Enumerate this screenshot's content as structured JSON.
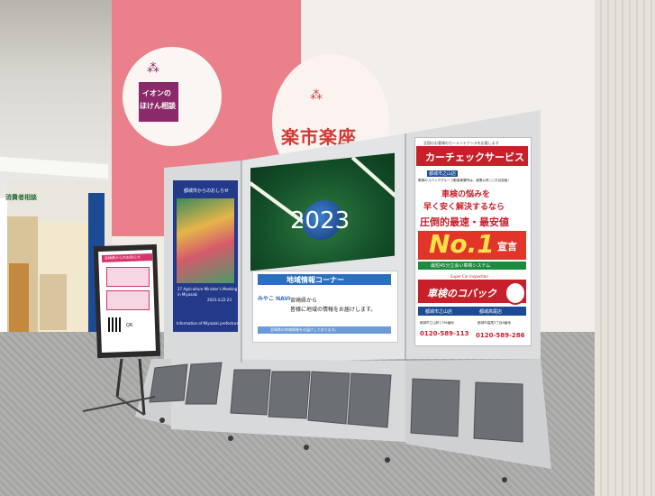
{
  "wall_signs": {
    "insurance_line1": "イオンの",
    "insurance_line2": "ほけん相談",
    "rakuichi": "楽市楽座"
  },
  "left_screen": {
    "heading": "都城市からのおしらせ",
    "event_line1": "27 Agriculture Minister's Meeting",
    "event_line2": "in Miyazaki",
    "date": "2023.4.22-23",
    "footer": "Information of Miyazaki prefecture"
  },
  "center_screen": {
    "year": "2023"
  },
  "regional_panel": {
    "title": "地域情報コーナー",
    "logo_text": "みやこ NAVI",
    "line1": "宮崎県から",
    "line2": "皆様に地域の情報をお届けします。",
    "footnote": "宮崎県の地域情報をお届けしております。"
  },
  "right_ad": {
    "tagline": "全国のお客様のカーメンテナンスを応援します",
    "brand": "カーチェックサービス",
    "store_label": "都城市之山店",
    "intro": "車検のコバックグループ都城事業所は、創業以来○○万台突破！",
    "line1": "車検の悩みを",
    "line2": "早く安く解決するなら",
    "line3": "圧倒的最速・最安値",
    "no1": "No.1",
    "sengen": "宣言",
    "system": "最短45分立会い車検システム",
    "inspection": "Super Car Inspection",
    "kobac": "車検のコバック",
    "store1_name": "都城市之山店",
    "store1_phone": "0120-589-113",
    "store2_name": "都城高尾店",
    "store2_phone": "0120-589-286",
    "store1_address": "都城市之山町1796番地",
    "store2_address": "都城市高尾3丁目6番地"
  },
  "easel_sign": {
    "header": "宮崎県からのお知らせ",
    "code_label": "QR"
  },
  "corridor_sign": "消費者相談"
}
